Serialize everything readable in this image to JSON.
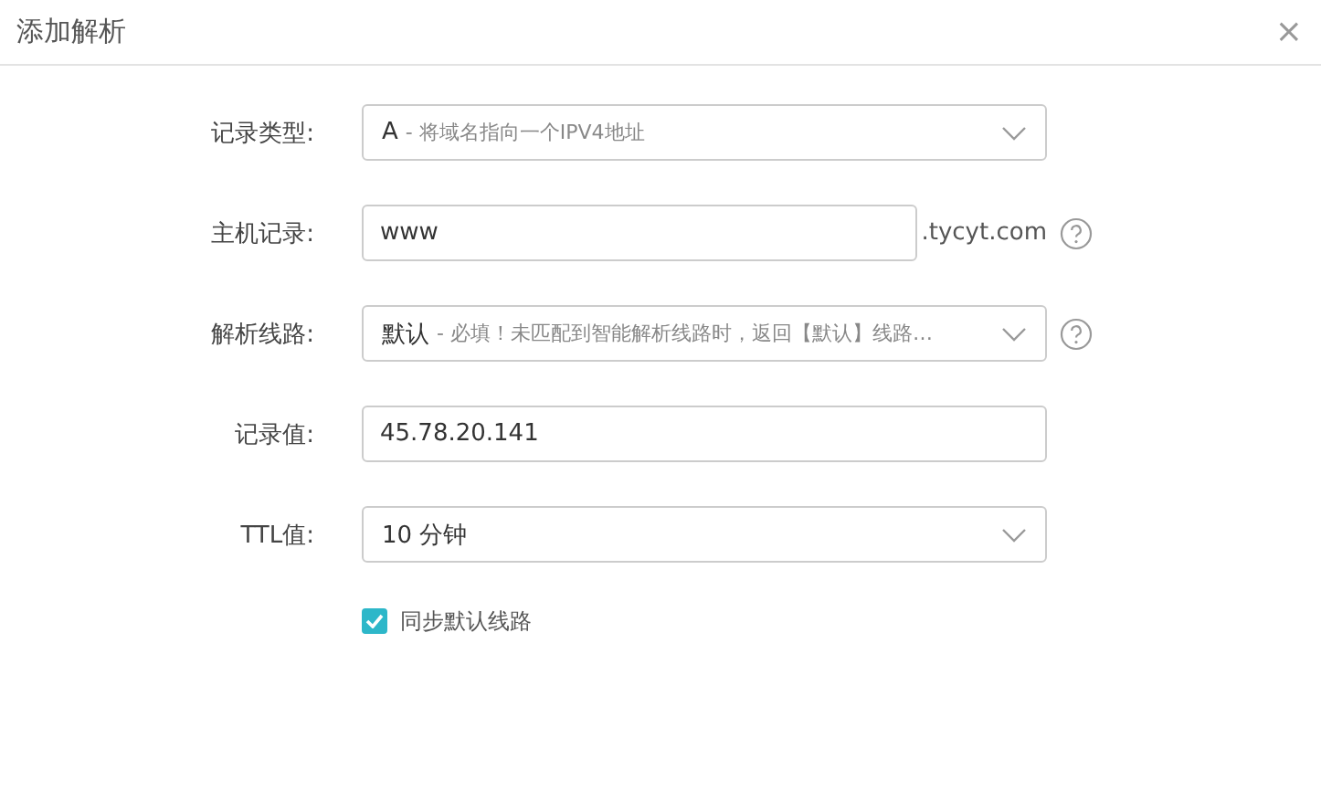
{
  "dialog": {
    "title": "添加解析",
    "close": "×"
  },
  "fields": [
    {
      "kind": "select",
      "label": "记录类型:",
      "value": "A",
      "hint": "- 将域名指向一个IPV4地址",
      "help": false
    },
    {
      "kind": "input",
      "label": "主机记录:",
      "value": "www",
      "suffix": ".tycyt.com",
      "help": true
    },
    {
      "kind": "select",
      "label": "解析线路:",
      "value": "默认",
      "hint": "- 必填！未匹配到智能解析线路时，返回【默认】线路…",
      "help": true
    },
    {
      "kind": "input",
      "label": "记录值:",
      "value": "45.78.20.141",
      "help": false
    },
    {
      "kind": "select",
      "label": "TTL值:",
      "value": "10 分钟",
      "help": false
    }
  ],
  "sync": {
    "label": "同步默认线路",
    "checked": true
  }
}
